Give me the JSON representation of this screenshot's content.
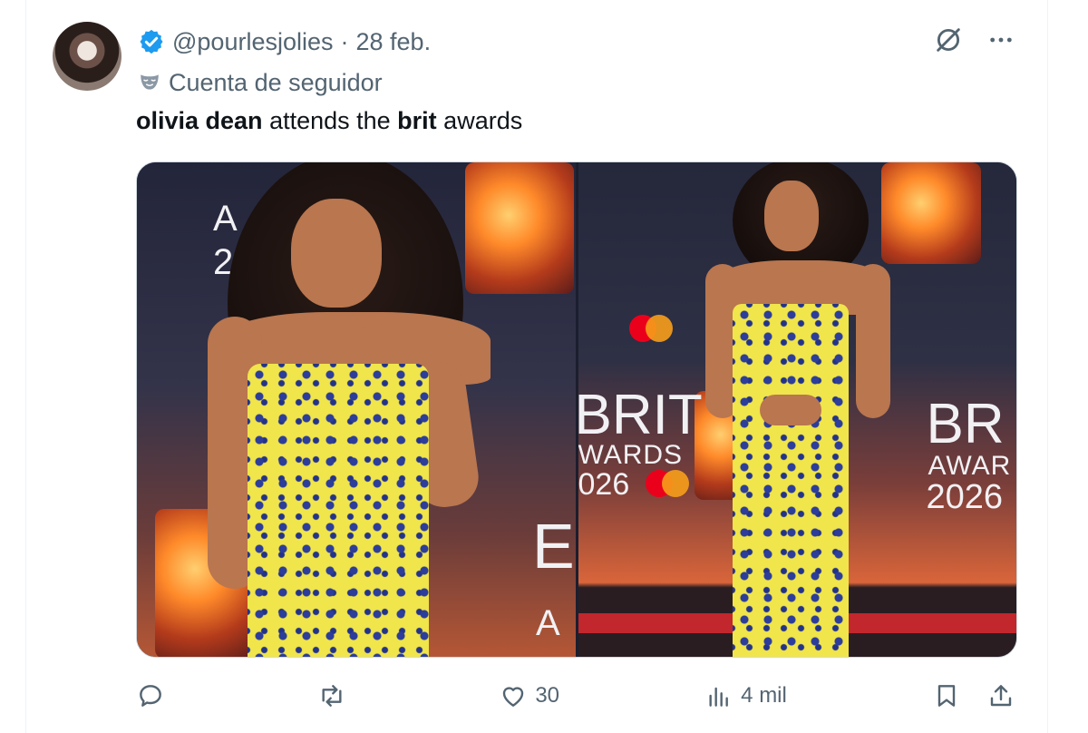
{
  "tweet": {
    "handle": "@pourlesjolies",
    "separator": "·",
    "date": "28 feb.",
    "account_label": "Cuenta de seguidor",
    "text_parts": [
      "olivia dean",
      " attends the ",
      "brit",
      " awards"
    ]
  },
  "media": {
    "left_logo": {
      "line1": "A",
      "line2": "2"
    },
    "left_logo_bottom": {
      "line1": "E",
      "line2": "A"
    },
    "right_logo_left": {
      "line1": "BRIT",
      "line2": "WARDS",
      "line3": "026"
    },
    "right_logo_right": {
      "line1": "BR",
      "line2": "AWAR",
      "line3": "2026"
    }
  },
  "actions": {
    "reply_count": "",
    "repost_count": "",
    "like_count": "30",
    "views_count": "4 mil"
  },
  "colors": {
    "verified": "#1d9bf0",
    "secondary_text": "#536471",
    "dress_yellow": "#f0e54a",
    "dress_flower": "#2c3d9a"
  }
}
